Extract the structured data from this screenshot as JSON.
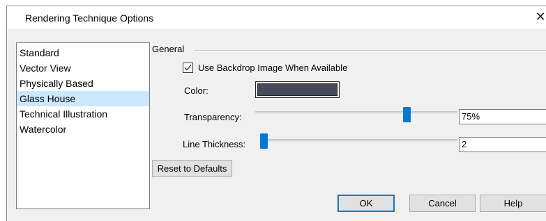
{
  "dialog": {
    "title": "Rendering Technique Options",
    "close_glyph": "✕"
  },
  "techniques": {
    "items": [
      "Standard",
      "Vector View",
      "Physically Based",
      "Glass House",
      "Technical Illustration",
      "Watercolor"
    ],
    "selected": "Glass House"
  },
  "general": {
    "legend": "General",
    "backdrop_label": "Use Backdrop Image When Available",
    "backdrop_checked": true,
    "color_label": "Color:",
    "color_value": "#454b5c",
    "transparency_label": "Transparency:",
    "transparency_value": "75%",
    "transparency_fraction": 0.75,
    "line_thickness_label": "Line Thickness:",
    "line_thickness_value": "2",
    "line_thickness_fraction": 0.02,
    "reset_label": "Reset to Defaults"
  },
  "footer": {
    "ok_label": "OK",
    "cancel_label": "Cancel",
    "help_label": "Help"
  },
  "colors": {
    "accent": "#0078d7",
    "selection": "#cce8ff"
  }
}
